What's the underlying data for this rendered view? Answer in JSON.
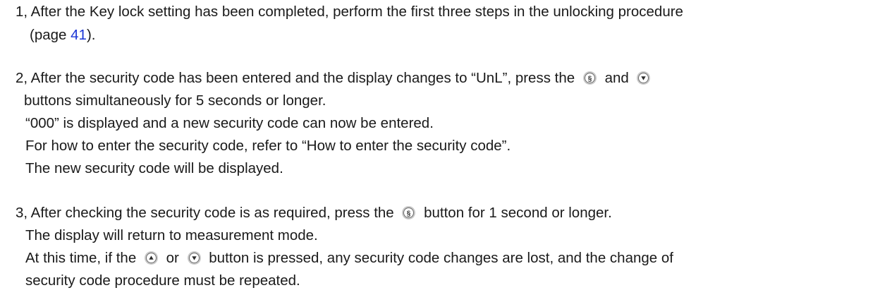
{
  "step1": {
    "line1": "1, After the Key lock setting has been completed, perform the first three steps in the unlocking procedure",
    "line2_prefix": "(page ",
    "line2_link": "41",
    "line2_suffix": ")."
  },
  "step2": {
    "line1_a": "2, After the security code has been entered and the display changes to “UnL”, press the",
    "line1_b": "and",
    "line2": "buttons simultaneously for 5 seconds or longer.",
    "line3": "“000” is displayed and a new security code can now be entered.",
    "line4": "For how to enter the security code, refer to “How to enter the security code”.",
    "line5": "The new security code will be displayed."
  },
  "step3": {
    "line1_a": "3, After checking the security code is as required, press the",
    "line1_b": "button for 1 second or longer.",
    "line2": "The display will return to measurement mode.",
    "line3_a": "At this time, if the",
    "line3_b": "or",
    "line3_c": "button is pressed, any security code changes are lost, and the change of",
    "line4": "security code procedure must be repeated."
  },
  "icons": {
    "s_button": "s-button-icon",
    "down_button": "down-arrow-button-icon",
    "up_button": "up-arrow-button-icon"
  },
  "colors": {
    "text": "#1a1a1a",
    "link": "#1a35d6",
    "button_ring": "#c9c9c9"
  }
}
